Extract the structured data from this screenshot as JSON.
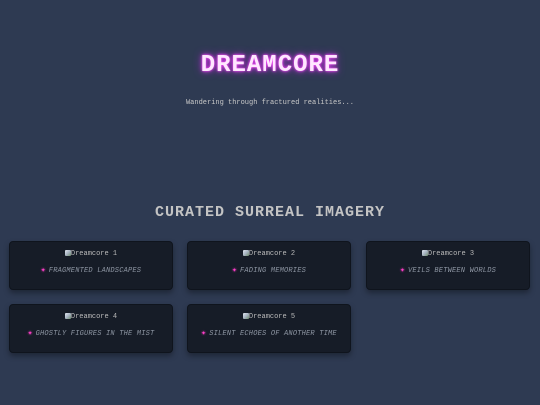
{
  "header": {
    "title": "DREAMCORE",
    "tagline": "Wandering through fractured realities..."
  },
  "gallery": {
    "heading": "CURATED SURREAL IMAGERY",
    "sparkle_glyph": "✦",
    "sparkle_icon": "sparkle-icon",
    "accent_color": "#ff3ec8",
    "items": [
      {
        "alt": "Dreamcore 1",
        "caption": "FRAGMENTED LANDSCAPES"
      },
      {
        "alt": "Dreamcore 2",
        "caption": "FADING MEMORIES"
      },
      {
        "alt": "Dreamcore 3",
        "caption": "VEILS BETWEEN WORLDS"
      },
      {
        "alt": "Dreamcore 4",
        "caption": "GHOSTLY FIGURES IN THE MIST"
      },
      {
        "alt": "Dreamcore 5",
        "caption": "SILENT ECHOES OF ANOTHER TIME"
      }
    ]
  }
}
